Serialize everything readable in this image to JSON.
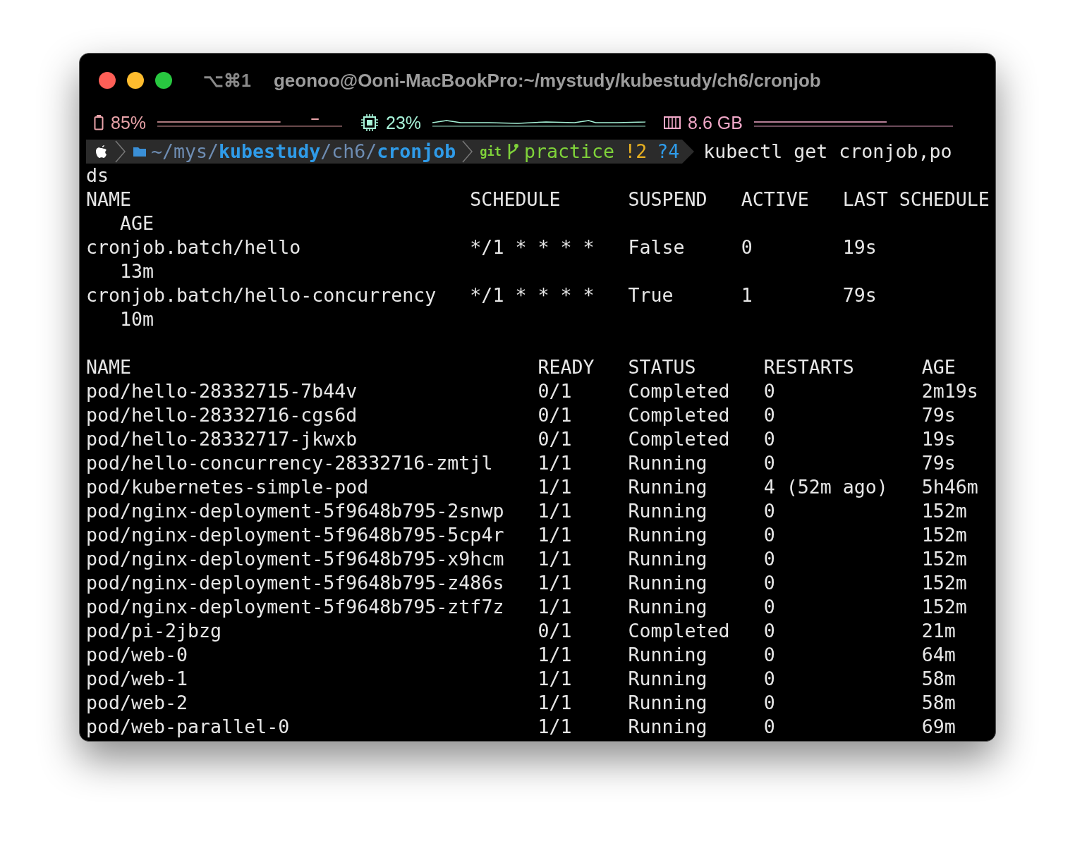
{
  "window": {
    "title": "geonoo@Ooni-MacBookPro:~/mystudy/kubestudy/ch6/cronjob",
    "shortcut": "⌥⌘1"
  },
  "status_bar": [
    {
      "kind": "battery",
      "reading": "85%",
      "color": "#e9a3a9"
    },
    {
      "kind": "cpu",
      "reading": "23%",
      "color": "#a7f3d8"
    },
    {
      "kind": "memory",
      "reading": "8.6 GB",
      "color": "#f2a9c9"
    }
  ],
  "prompt": {
    "path": [
      {
        "text": "~/mys/",
        "kind": "dim"
      },
      {
        "text": "kubestudy",
        "kind": "bold"
      },
      {
        "text": "/ch6/",
        "kind": "dim"
      },
      {
        "text": "cronjob",
        "kind": "bold"
      }
    ],
    "git": {
      "label": "git",
      "branch": "practice",
      "modified": "!2",
      "untracked": "?4"
    },
    "command": "kubectl get cronjob,po",
    "command_continued": "ds"
  },
  "cronjobs": {
    "columns": [
      "NAME",
      "SCHEDULE",
      "SUSPEND",
      "ACTIVE",
      "LAST SCHEDULE",
      "AGE"
    ],
    "rows": [
      [
        "cronjob.batch/hello",
        "*/1 * * * *",
        "False",
        "0",
        "19s",
        "13m"
      ],
      [
        "cronjob.batch/hello-concurrency",
        "*/1 * * * *",
        "True",
        "1",
        "79s",
        "10m"
      ]
    ]
  },
  "pods": {
    "columns": [
      "NAME",
      "READY",
      "STATUS",
      "RESTARTS",
      "AGE"
    ],
    "rows": [
      [
        "pod/hello-28332715-7b44v",
        "0/1",
        "Completed",
        "0",
        "2m19s"
      ],
      [
        "pod/hello-28332716-cgs6d",
        "0/1",
        "Completed",
        "0",
        "79s"
      ],
      [
        "pod/hello-28332717-jkwxb",
        "0/1",
        "Completed",
        "0",
        "19s"
      ],
      [
        "pod/hello-concurrency-28332716-zmtjl",
        "1/1",
        "Running",
        "0",
        "79s"
      ],
      [
        "pod/kubernetes-simple-pod",
        "1/1",
        "Running",
        "4 (52m ago)",
        "5h46m"
      ],
      [
        "pod/nginx-deployment-5f9648b795-2snwp",
        "1/1",
        "Running",
        "0",
        "152m"
      ],
      [
        "pod/nginx-deployment-5f9648b795-5cp4r",
        "1/1",
        "Running",
        "0",
        "152m"
      ],
      [
        "pod/nginx-deployment-5f9648b795-x9hcm",
        "1/1",
        "Running",
        "0",
        "152m"
      ],
      [
        "pod/nginx-deployment-5f9648b795-z486s",
        "1/1",
        "Running",
        "0",
        "152m"
      ],
      [
        "pod/nginx-deployment-5f9648b795-ztf7z",
        "1/1",
        "Running",
        "0",
        "152m"
      ],
      [
        "pod/pi-2jbzg",
        "0/1",
        "Completed",
        "0",
        "21m"
      ],
      [
        "pod/web-0",
        "1/1",
        "Running",
        "0",
        "64m"
      ],
      [
        "pod/web-1",
        "1/1",
        "Running",
        "0",
        "58m"
      ],
      [
        "pod/web-2",
        "1/1",
        "Running",
        "0",
        "58m"
      ],
      [
        "pod/web-parallel-0",
        "1/1",
        "Running",
        "0",
        "69m"
      ]
    ]
  }
}
